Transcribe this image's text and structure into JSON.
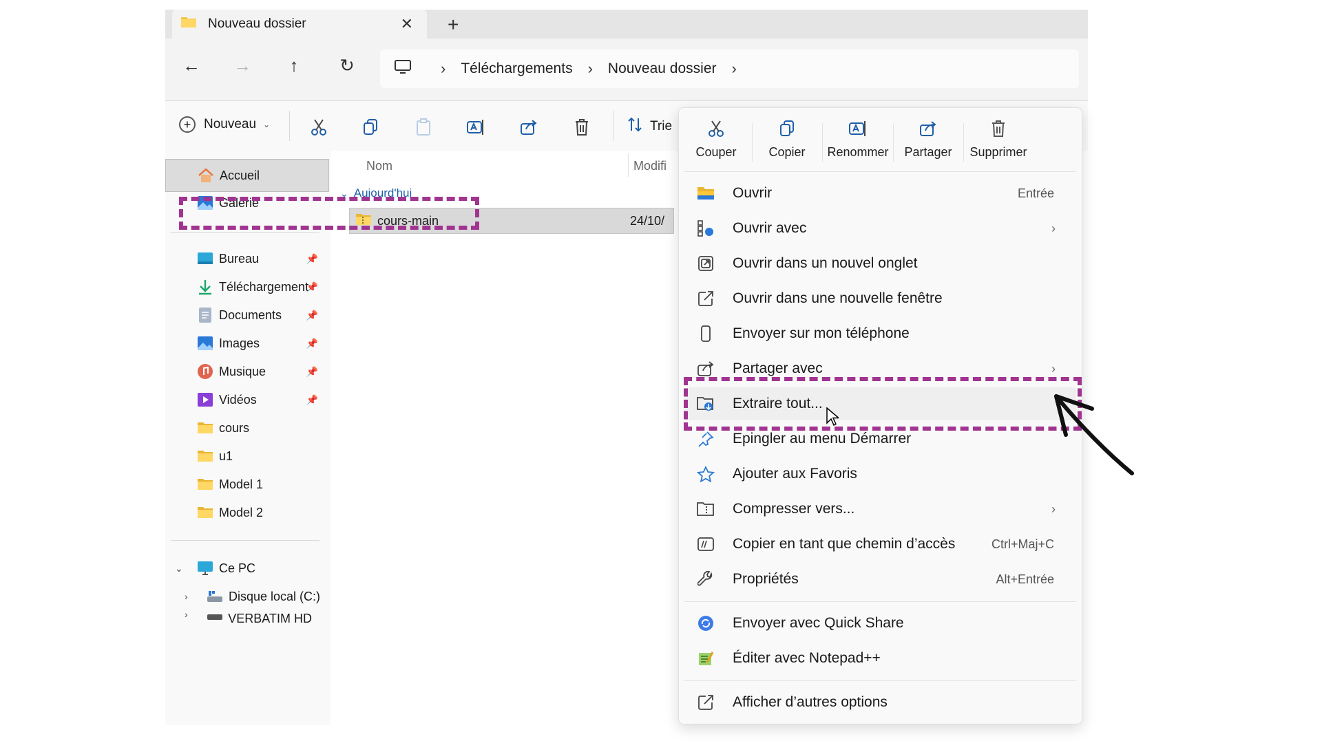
{
  "tab": {
    "title": "Nouveau dossier",
    "close": "✕",
    "new_tab": "+"
  },
  "nav": {
    "back": "←",
    "forward": "→",
    "up": "↑",
    "refresh": "↻"
  },
  "address": {
    "crumbs": [
      "Téléchargements",
      "Nouveau dossier"
    ],
    "separator": "›"
  },
  "command_bar": {
    "new_label": "Nouveau",
    "sort_label": "Trie"
  },
  "sidebar": {
    "home": "Accueil",
    "gallery": "Galerie",
    "pinned": [
      {
        "label": "Bureau",
        "icon": "desktop-icon"
      },
      {
        "label": "Téléchargement",
        "icon": "download-icon"
      },
      {
        "label": "Documents",
        "icon": "documents-icon"
      },
      {
        "label": "Images",
        "icon": "images-icon"
      },
      {
        "label": "Musique",
        "icon": "music-icon"
      },
      {
        "label": "Vidéos",
        "icon": "videos-icon"
      },
      {
        "label": "cours",
        "icon": "folder-icon"
      },
      {
        "label": "u1",
        "icon": "folder-icon"
      },
      {
        "label": "Model 1",
        "icon": "folder-icon"
      },
      {
        "label": "Model 2",
        "icon": "folder-icon"
      }
    ],
    "this_pc": "Ce PC",
    "drives": [
      "Disque local (C:)",
      "VERBATIM HD (D:"
    ]
  },
  "main": {
    "col_name": "Nom",
    "col_modified": "Modifi",
    "group": "Aujourd'hui",
    "file_name": "cours-main",
    "file_date": "24/10/"
  },
  "context_menu": {
    "quick_actions": [
      "Couper",
      "Copier",
      "Renommer",
      "Partager",
      "Supprimer"
    ],
    "items": [
      {
        "label": "Ouvrir",
        "accel": "Entrée",
        "submenu": false
      },
      {
        "label": "Ouvrir avec",
        "accel": "",
        "submenu": true
      },
      {
        "label": "Ouvrir dans un nouvel onglet",
        "accel": "",
        "submenu": false
      },
      {
        "label": "Ouvrir dans une nouvelle fenêtre",
        "accel": "",
        "submenu": false
      },
      {
        "label": "Envoyer sur mon téléphone",
        "accel": "",
        "submenu": false
      },
      {
        "label": "Partager avec",
        "accel": "",
        "submenu": true
      },
      {
        "label": "Extraire tout...",
        "accel": "",
        "submenu": false
      },
      {
        "label": "Epingler au menu Démarrer",
        "accel": "",
        "submenu": false
      },
      {
        "label": "Ajouter aux Favoris",
        "accel": "",
        "submenu": false
      },
      {
        "label": "Compresser vers...",
        "accel": "",
        "submenu": true
      },
      {
        "label": "Copier en tant que chemin d’accès",
        "accel": "Ctrl+Maj+C",
        "submenu": false
      },
      {
        "label": "Propriétés",
        "accel": "Alt+Entrée",
        "submenu": false
      },
      {
        "label": "Envoyer avec Quick Share",
        "accel": "",
        "submenu": false
      },
      {
        "label": "Éditer avec Notepad++",
        "accel": "",
        "submenu": false
      },
      {
        "label": "Afficher d’autres options",
        "accel": "",
        "submenu": false
      }
    ],
    "submenu_glyph": "›"
  },
  "colors": {
    "highlight_dash": "#a03490",
    "folder": "#f4c542",
    "link_blue": "#1f5fa8"
  }
}
